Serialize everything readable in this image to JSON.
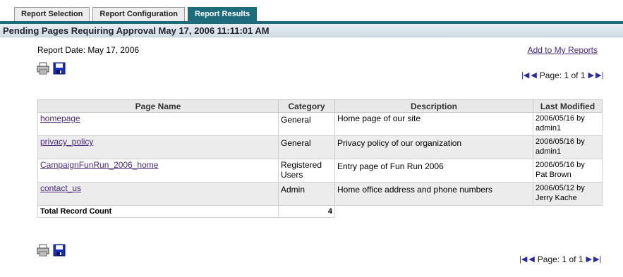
{
  "tabs": [
    {
      "label": "Report Selection"
    },
    {
      "label": "Report Configuration"
    },
    {
      "label": "Report Results"
    }
  ],
  "header": {
    "title": "Pending Pages Requiring Approval May 17, 2006 11:11:01 AM"
  },
  "report": {
    "date_label": "Report Date: May 17, 2006",
    "add_link": "Add to My Reports"
  },
  "pager": {
    "label": "Page: 1 of 1"
  },
  "table": {
    "columns": [
      "Page Name",
      "Category",
      "Description",
      "Last Modified"
    ],
    "rows": [
      {
        "page": "homepage",
        "category": "General",
        "description": "Home page of our site",
        "modified": "2006/05/16 by",
        "by": "admin1"
      },
      {
        "page": "privacy_policy",
        "category": "General",
        "description": "Privacy policy of our organization",
        "modified": "2006/05/16 by",
        "by": "admin1"
      },
      {
        "page": "CampaignFunRun_2006_home",
        "category": "Registered Users",
        "description": "Entry page of Fun Run 2006",
        "modified": "2006/05/16 by",
        "by": "Pat Brown"
      },
      {
        "page": "contact_us",
        "category": "Admin",
        "description": "Home office address and phone numbers",
        "modified": "2006/05/12 by",
        "by": "Jerry Kache"
      }
    ],
    "total_label": "Total Record Count",
    "total_value": "4"
  },
  "icons": {
    "print": "print-icon",
    "save": "save-icon",
    "first": "first-page-icon",
    "prev": "prev-page-icon",
    "next": "next-page-icon",
    "last": "last-page-icon"
  },
  "colors": {
    "tab_active": "#1e6b7c",
    "link": "#4a2a7a",
    "pager_arrow": "#2a2aa8"
  }
}
